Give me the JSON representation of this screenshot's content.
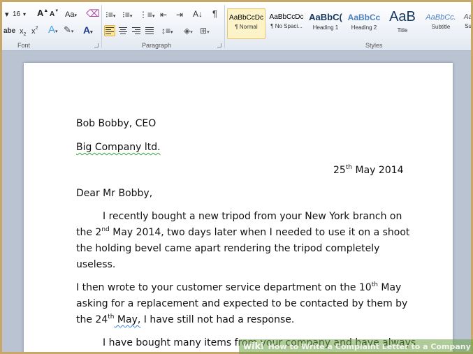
{
  "ribbon": {
    "font_size": "16",
    "grow_font": "A",
    "shrink_font": "A",
    "change_case": "Aa",
    "font_group_label": "Font",
    "paragraph_group_label": "Paragraph",
    "styles_group_label": "Styles",
    "styles": [
      {
        "sample": "AaBbCcDc",
        "name": "¶ Normal"
      },
      {
        "sample": "AaBbCcDc",
        "name": "¶ No Spaci..."
      },
      {
        "sample": "AaBbC(",
        "name": "Heading 1"
      },
      {
        "sample": "AaBbCc",
        "name": "Heading 2"
      },
      {
        "sample": "AaB",
        "name": "Title"
      },
      {
        "sample": "AaBbCc.",
        "name": "Subtitle"
      },
      {
        "sample": "Aa",
        "name": "Su"
      }
    ]
  },
  "document": {
    "line1": "Bob Bobby, CEO",
    "line2": "Big Company ltd.",
    "date_day": "25",
    "date_sup": "th",
    "date_rest": " May 2014",
    "salutation": "Dear Mr Bobby,",
    "p1_l1": "I recently bought a new tripod from your New York branch on",
    "p1_l2a": "the 2",
    "p1_l2sup": "nd",
    "p1_l2b": " May 2014, two days later when I needed to use it on a shoot",
    "p1_l3": "the holding bevel came apart rendering the tripod completely",
    "p1_l4": "useless.",
    "p2_l1a": "I then wrote to your customer service department on the 10",
    "p2_l1sup": "th",
    "p2_l1b": " May",
    "p2_l2": "asking for a replacement and expected to be contacted by them by",
    "p2_l3a": "the 24",
    "p2_l3sup": "th",
    "p2_l3b": " May,",
    "p2_l3c": " I have still not had a response.",
    "p3_l1": "I have bought many items from your company and have always"
  },
  "watermark": {
    "logo": "wiki",
    "text": "How to Write a Complaint Letter to a Company"
  },
  "colors": {
    "border": "#c8a86a",
    "ribbon": "#eef2f8",
    "selected_style": "#fdf3c8",
    "grammar_squiggle": "#3aa23a"
  }
}
